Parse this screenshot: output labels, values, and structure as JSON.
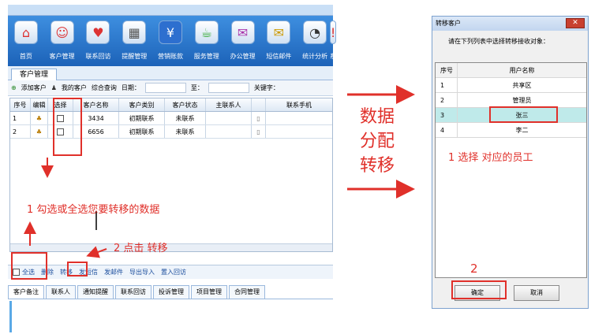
{
  "app": {
    "ribbon": [
      {
        "label": "首页",
        "icon": "home-icon"
      },
      {
        "label": "客户管理",
        "icon": "customer-icon"
      },
      {
        "label": "联系回访",
        "icon": "heart-icon"
      },
      {
        "label": "提醒管理",
        "icon": "calendar-icon"
      },
      {
        "label": "营销账款",
        "icon": "yen-icon"
      },
      {
        "label": "服务管理",
        "icon": "service-icon"
      },
      {
        "label": "办公管理",
        "icon": "office-icon"
      },
      {
        "label": "短信邮件",
        "icon": "mail-icon"
      },
      {
        "label": "统计分析",
        "icon": "stats-icon"
      },
      {
        "label": "系",
        "icon": "system-icon"
      }
    ],
    "module_tab": "客户管理",
    "toolbar": {
      "add": "添加客户",
      "mine": "我的客户",
      "query": "综合查询",
      "date": "日期：",
      "to": "至：",
      "keyword": "关键字："
    },
    "grid": {
      "headers": [
        "序号",
        "编辑",
        "选择",
        "客户名称",
        "客户类别",
        "客户状态",
        "主联系人",
        "",
        "联系手机"
      ],
      "rows": [
        {
          "no": "1",
          "name": "3434",
          "type": "初期联系",
          "status": "未联系"
        },
        {
          "no": "2",
          "name": "6656",
          "type": "初期联系",
          "status": "未联系"
        }
      ]
    },
    "bottom": {
      "select_all": "全选",
      "delete": "删除",
      "transfer": "转移",
      "sms": "发短信",
      "mail": "发邮件",
      "import_export": "导出导入",
      "import_visit": "置入回访"
    },
    "subtabs": [
      "客户备注",
      "联系人",
      "通知提醒",
      "联系回访",
      "投诉管理",
      "项目管理",
      "合同管理"
    ]
  },
  "annotations": {
    "step1_left": "1 勾选或全选您要转移的数据",
    "step2_left": "2 点击 转移",
    "middle_text": "数据\n分配\n转移",
    "step1_right": "1 选择 对应的员工",
    "step2_right": "2"
  },
  "dialog": {
    "title": "转移客户",
    "close": "✕",
    "prompt": "请在下列列表中选择转移接收对象：",
    "col_no": "序号",
    "col_user": "用户名称",
    "users": [
      {
        "no": "1",
        "name": "共享区"
      },
      {
        "no": "2",
        "name": "管理员"
      },
      {
        "no": "3",
        "name": "张三"
      },
      {
        "no": "4",
        "name": "李二"
      }
    ],
    "ok": "确定",
    "cancel": "取消"
  },
  "colors": {
    "annotation": "#e0302a",
    "ribbon": "#1c62b8",
    "selected_row": "#bfeaea"
  }
}
